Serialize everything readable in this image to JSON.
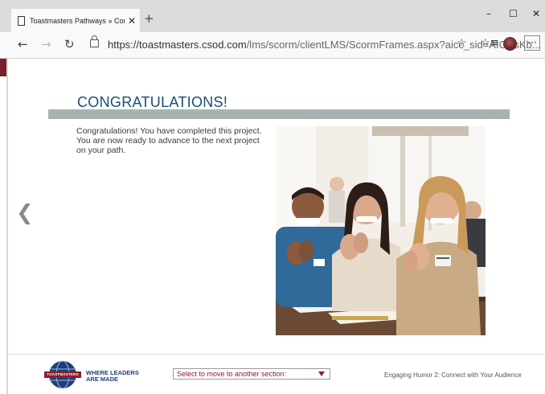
{
  "browser": {
    "tab_title": "Toastmasters Pathways » Connec",
    "tab_close": "✕",
    "new_tab": "+",
    "window_controls": {
      "minimize": "–",
      "maximize": "☐",
      "close": "✕"
    },
    "nav": {
      "back": "←",
      "forward": "→",
      "refresh": "↻"
    },
    "url_host": "https://toastmasters.csod.com",
    "url_path": "/lms/scorm/clientLMS/ScormFrames.aspx?aicc_sid=AICCsKb...",
    "favorite": "☆",
    "favorites_bar": "☆≡",
    "more": "···"
  },
  "content": {
    "heading": "CONGRATULATIONS!",
    "body_line1": "Congratulations! You have completed this project.",
    "body_line2": "You are now ready to advance to the next project",
    "body_line3": "on your path.",
    "prev_arrow": "❮"
  },
  "footer": {
    "logo_text": "TOASTMASTERS",
    "tagline_line1": "WHERE LEADERS",
    "tagline_line2": "ARE MADE",
    "section_select": "Select to move to another section:",
    "course_title": "Engaging Humor 2: Connect with Your Audience"
  },
  "colors": {
    "heading": "#1a4e72",
    "rule": "#a7b3b3",
    "brand_maroon": "#8b1d2c",
    "brand_blue": "#1f3f7a"
  }
}
